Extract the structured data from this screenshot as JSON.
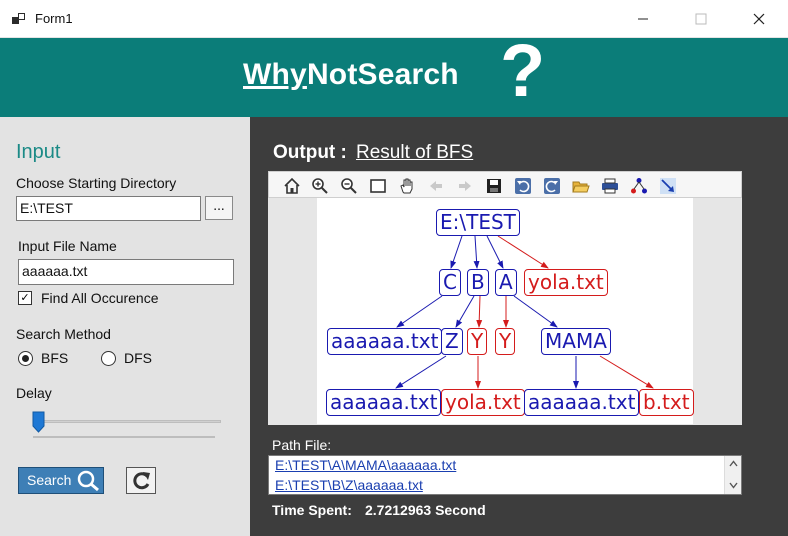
{
  "window": {
    "title": "Form1",
    "icons": {
      "app": "app-form-icon",
      "minimize": "minimize-icon",
      "maximize": "maximize-icon",
      "close": "close-icon"
    }
  },
  "banner": {
    "brand_underlined": "Why",
    "brand_rest": "NotSearch",
    "mark": "?",
    "color": "#0b7d79"
  },
  "input": {
    "heading": "Input",
    "dir_label": "Choose Starting Directory",
    "dir_value": "E:\\TEST",
    "browse_label": "...",
    "file_label": "Input File Name",
    "file_value": "aaaaaa.txt",
    "find_all_label": "Find All Occurence",
    "find_all_checked": true,
    "method_label": "Search Method",
    "method_options": [
      "BFS",
      "DFS"
    ],
    "method_selected": "BFS",
    "delay_label": "Delay",
    "search_label": "Search",
    "icons": {
      "search": "magnifier-icon",
      "refresh": "refresh-icon"
    }
  },
  "output": {
    "title": "Output :",
    "subtitle": "Result of BFS",
    "toolbar": [
      "home-icon",
      "zoom-in-icon",
      "zoom-out-icon",
      "zoom-window-icon",
      "pan-hand-icon",
      "back-arrow-icon",
      "forward-arrow-icon",
      "save-icon",
      "undo-icon",
      "redo-icon",
      "open-folder-icon",
      "print-icon",
      "layout-icon",
      "edit-edge-icon"
    ],
    "tree": {
      "root": "E:\\TEST",
      "level1": [
        "C",
        "B",
        "A",
        "yola.txt"
      ],
      "level2": [
        "aaaaaa.txt",
        "Z",
        "Y",
        "Y",
        "MAMA"
      ],
      "level3": [
        "aaaaaa.txt",
        "yola.txt",
        "aaaaaa.txt",
        "b.txt"
      ]
    },
    "colors": {
      "found": "#1a1ab0",
      "not_found": "#d41c1c"
    },
    "path_label": "Path File:",
    "paths": [
      "E:\\TEST\\A\\MAMA\\aaaaaa.txt",
      "E:\\TEST\\B\\Z\\aaaaaa.txt"
    ],
    "time_label": "Time Spent:",
    "time_value": "2.7212963 Second"
  }
}
